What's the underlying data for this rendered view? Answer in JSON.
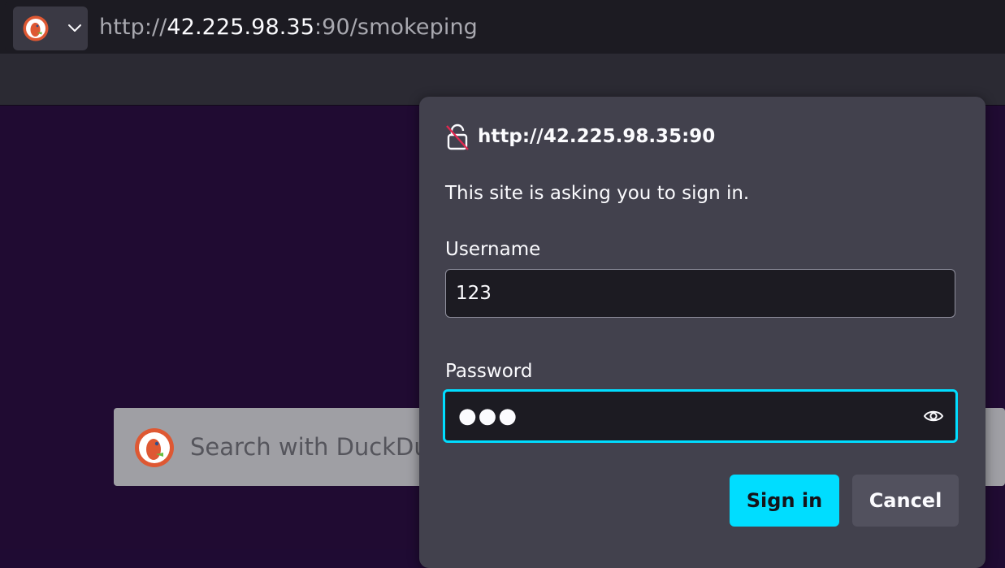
{
  "browser": {
    "url_prefix": "http://",
    "url_host": "42.225.98.35",
    "url_rest": ":90/smokeping",
    "search_engine_icon": "duckduckgo-icon"
  },
  "page": {
    "search_placeholder": "Search with DuckDu"
  },
  "auth_dialog": {
    "origin": "http://42.225.98.35:90",
    "message": "This site is asking you to sign in.",
    "username_label": "Username",
    "username_value": "123",
    "password_label": "Password",
    "password_value": "●●●",
    "sign_in_label": "Sign in",
    "cancel_label": "Cancel"
  },
  "colors": {
    "accent": "#00ddff",
    "dialog_bg": "#42414d",
    "page_bg": "#200b32"
  }
}
